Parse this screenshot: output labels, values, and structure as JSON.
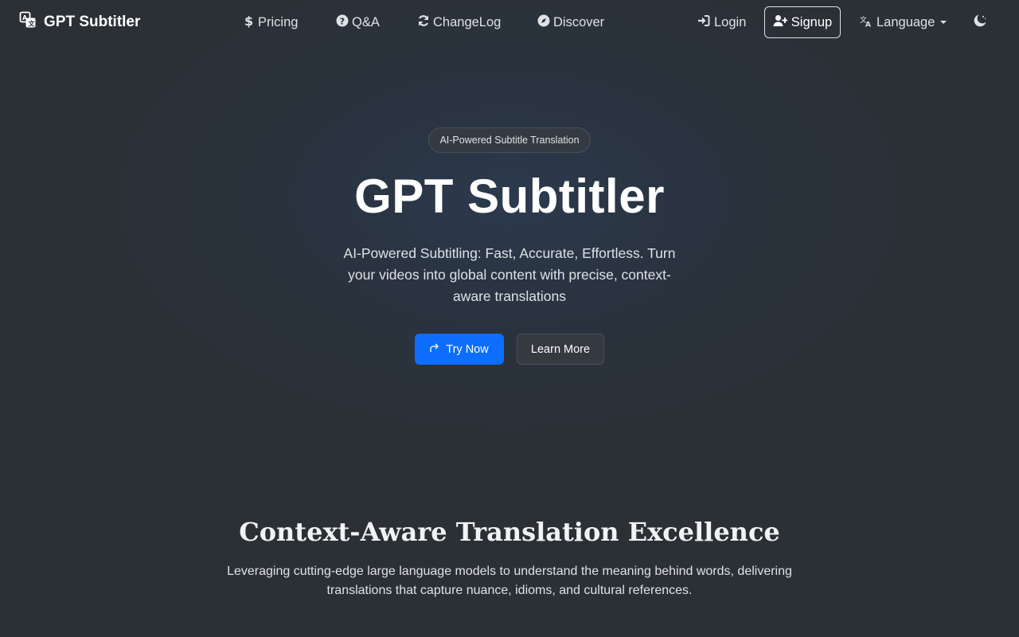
{
  "brand": {
    "name": "GPT Subtitler",
    "icon": "translate-logo-icon"
  },
  "nav": {
    "pricing": {
      "label": "Pricing",
      "icon": "dollar-icon"
    },
    "qa": {
      "label": "Q&A",
      "icon": "question-circle-icon"
    },
    "changelog": {
      "label": "ChangeLog",
      "icon": "refresh-icon"
    },
    "discover": {
      "label": "Discover",
      "icon": "compass-icon"
    },
    "login": {
      "label": "Login",
      "icon": "sign-in-icon"
    },
    "signup": {
      "label": "Signup",
      "icon": "user-plus-icon"
    },
    "language": {
      "label": "Language",
      "icon": "translate-icon"
    },
    "theme": {
      "icon": "moon-stars-icon"
    }
  },
  "hero": {
    "badge": "AI-Powered Subtitle Translation",
    "title": "GPT Subtitler",
    "subtitle": "AI-Powered Subtitling: Fast, Accurate, Effortless. Turn your videos into global content with precise, context-aware translations",
    "try_now": "Try Now",
    "learn_more": "Learn More"
  },
  "feature": {
    "title": "Context-Aware Translation Excellence",
    "text": "Leveraging cutting-edge large language models to understand the meaning behind words, delivering translations that capture nuance, idioms, and cultural references."
  },
  "colors": {
    "primary": "#0d6efd",
    "background": "#2b3035",
    "text": "#dee2e6"
  }
}
